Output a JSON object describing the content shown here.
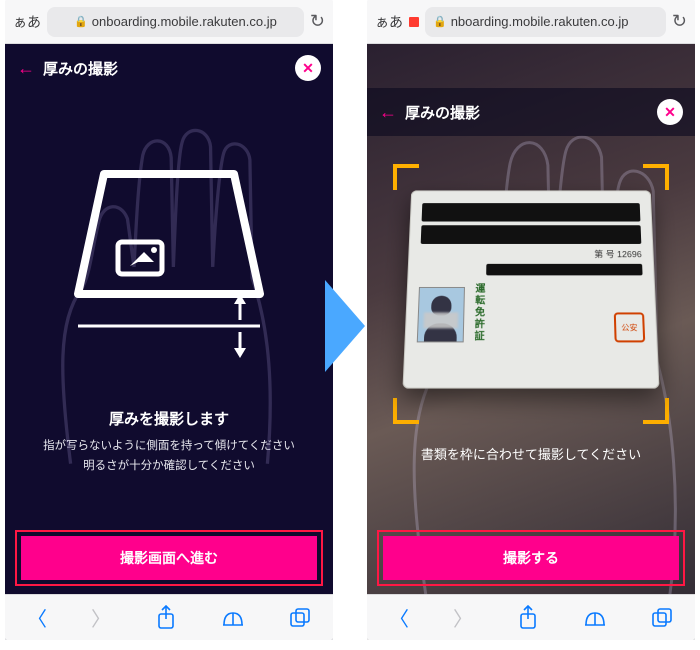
{
  "safari": {
    "aa_label": "ぁあ",
    "url": "onboarding.mobile.rakuten.co.jp",
    "url_truncated": "nboarding.mobile.rakuten.co.jp",
    "reload_glyph": "↻"
  },
  "screen1": {
    "header_title": "厚みの撮影",
    "instruction_title": "厚みを撮影します",
    "instruction_line1": "指が写らないように側面を持って傾けてください",
    "instruction_line2": "明るさが十分か確認してください",
    "cta_label": "撮影画面へ進む"
  },
  "screen2": {
    "header_title": "厚みの撮影",
    "instruction": "書類を枠に合わせて撮影してください",
    "cta_label": "撮影する",
    "card": {
      "number_label": "第       号   12696",
      "vertical_text": "運転免許証"
    }
  },
  "icons": {
    "close_glyph": "✕",
    "back_glyph": "←",
    "lock_glyph": "🔒",
    "share_glyph": "⬆",
    "book_glyph": "📖",
    "tabs_glyph": "⧉",
    "nav_back": "〈",
    "nav_fwd": "〉"
  }
}
